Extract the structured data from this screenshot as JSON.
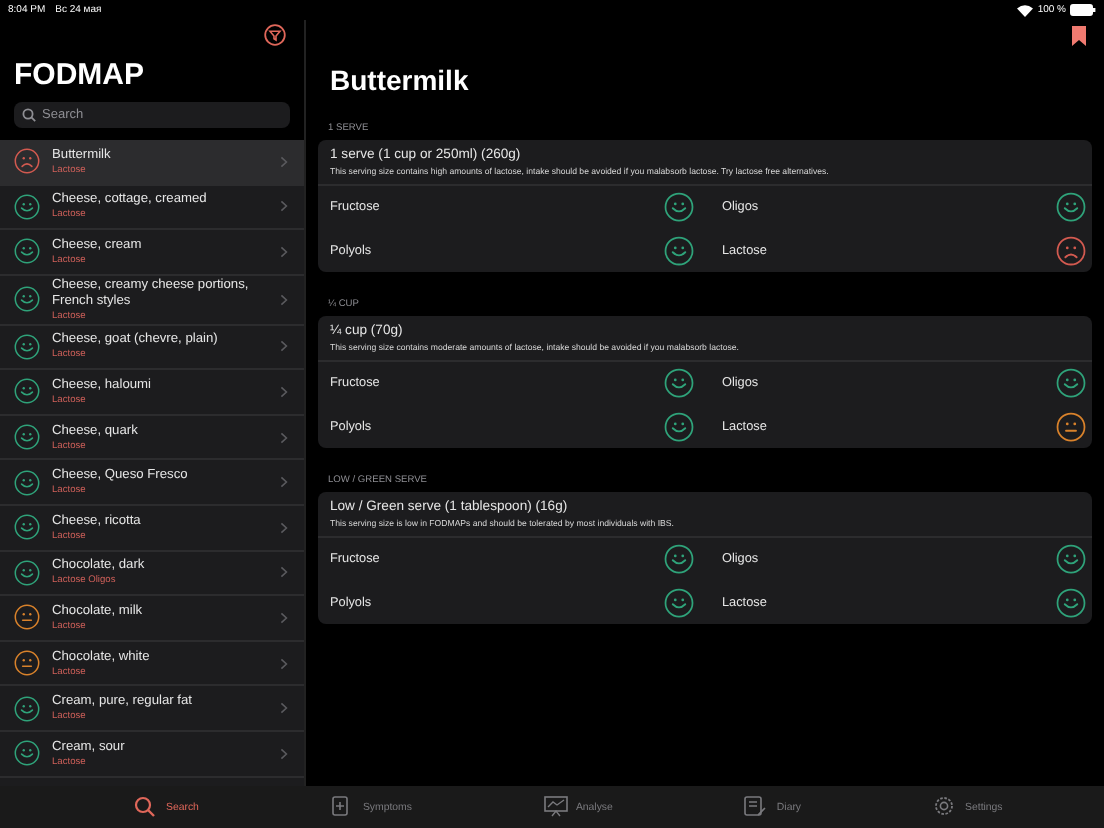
{
  "status_bar": {
    "time": "8:04 PM",
    "date": "Вс 24 мая",
    "battery": "100 %"
  },
  "sidebar": {
    "title": "FODMAP",
    "search": {
      "placeholder": "Search"
    },
    "items": [
      {
        "name": "Buttermilk",
        "tags": "Lactose",
        "kind": "sad",
        "selected": true
      },
      {
        "name": "Cheese, cottage, creamed",
        "tags": "Lactose",
        "kind": "happy",
        "selected": false
      },
      {
        "name": "Cheese, cream",
        "tags": "Lactose",
        "kind": "happy",
        "selected": false
      },
      {
        "name": "Cheese, creamy cheese portions, French styles",
        "tags": "Lactose",
        "kind": "happy",
        "selected": false
      },
      {
        "name": "Cheese, goat (chevre, plain)",
        "tags": "Lactose",
        "kind": "happy",
        "selected": false
      },
      {
        "name": "Cheese, haloumi",
        "tags": "Lactose",
        "kind": "happy",
        "selected": false
      },
      {
        "name": "Cheese, quark",
        "tags": "Lactose",
        "kind": "happy",
        "selected": false
      },
      {
        "name": "Cheese, Queso Fresco",
        "tags": "Lactose",
        "kind": "happy",
        "selected": false
      },
      {
        "name": "Cheese, ricotta",
        "tags": "Lactose",
        "kind": "happy",
        "selected": false
      },
      {
        "name": "Chocolate, dark",
        "tags": "Lactose Oligos",
        "kind": "happy",
        "selected": false
      },
      {
        "name": "Chocolate, milk",
        "tags": "Lactose",
        "kind": "neutral",
        "selected": false
      },
      {
        "name": "Chocolate, white",
        "tags": "Lactose",
        "kind": "neutral",
        "selected": false
      },
      {
        "name": "Cream, pure, regular fat",
        "tags": "Lactose",
        "kind": "happy",
        "selected": false
      },
      {
        "name": "Cream, sour",
        "tags": "Lactose",
        "kind": "happy",
        "selected": false
      }
    ]
  },
  "detail": {
    "title": "Buttermilk",
    "sections": [
      {
        "header": "1 SERVE",
        "title": "1 serve (1 cup or 250ml) (260g)",
        "description": "This serving size contains high amounts of lactose, intake should be avoided if you malabsorb lactose. Try lactose free alternatives.",
        "ratings": [
          {
            "label": "Fructose",
            "kind": "happy"
          },
          {
            "label": "Oligos",
            "kind": "happy"
          },
          {
            "label": "Polyols",
            "kind": "happy"
          },
          {
            "label": "Lactose",
            "kind": "sad"
          }
        ]
      },
      {
        "header": "¼ CUP",
        "title": "¼ cup (70g)",
        "description": "This serving size contains moderate amounts of lactose, intake should be avoided if you malabsorb lactose.",
        "ratings": [
          {
            "label": "Fructose",
            "kind": "happy"
          },
          {
            "label": "Oligos",
            "kind": "happy"
          },
          {
            "label": "Polyols",
            "kind": "happy"
          },
          {
            "label": "Lactose",
            "kind": "neutral"
          }
        ]
      },
      {
        "header": "LOW / GREEN SERVE",
        "title": "Low / Green serve (1 tablespoon) (16g)",
        "description": "This serving size is low in FODMAPs and should be tolerated by most individuals with IBS.",
        "ratings": [
          {
            "label": "Fructose",
            "kind": "happy"
          },
          {
            "label": "Oligos",
            "kind": "happy"
          },
          {
            "label": "Polyols",
            "kind": "happy"
          },
          {
            "label": "Lactose",
            "kind": "happy"
          }
        ]
      }
    ]
  },
  "tab_bar": [
    {
      "label": "Search",
      "selected": true
    },
    {
      "label": "Symptoms",
      "selected": false
    },
    {
      "label": "Analyse",
      "selected": false
    },
    {
      "label": "Diary",
      "selected": false
    },
    {
      "label": "Settings",
      "selected": false
    }
  ]
}
